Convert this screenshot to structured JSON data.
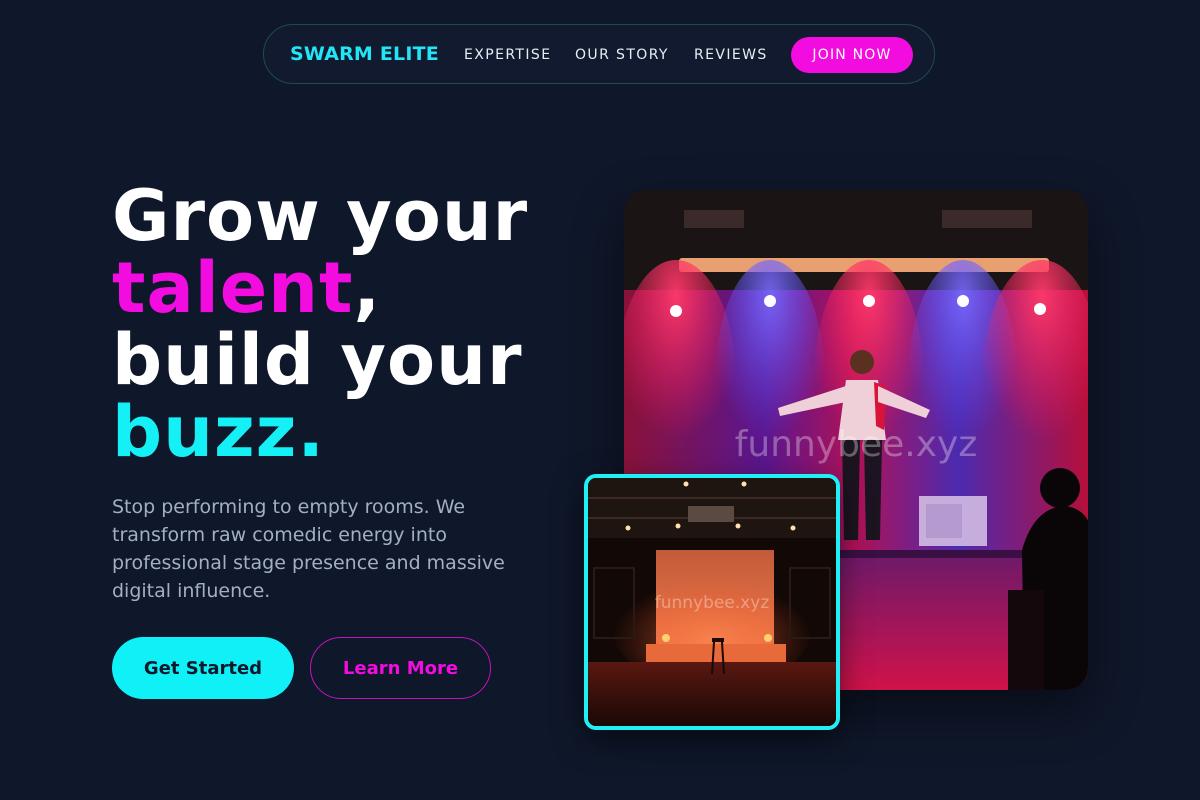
{
  "nav": {
    "brand": "SWARM ELITE",
    "links": [
      {
        "label": "EXPERTISE"
      },
      {
        "label": "OUR STORY"
      },
      {
        "label": "REVIEWS"
      }
    ],
    "cta_label": "JOIN NOW"
  },
  "hero": {
    "headline": {
      "part1": "Grow your",
      "part2_highlight": "talent",
      "part2_rest": ",",
      "part3": "build your",
      "part4_highlight": "buzz."
    },
    "subtext": "Stop performing to empty rooms. We transform raw comedic energy into professional stage presence and massive digital influence.",
    "primary_button": "Get Started",
    "secondary_button": "Learn More"
  },
  "images": {
    "main_watermark": "funnybee.xyz",
    "small_watermark": "funnybee.xyz"
  },
  "colors": {
    "background": "#0f172a",
    "cyan_accent": "#14f0f5",
    "magenta_accent": "#f20ce0"
  }
}
